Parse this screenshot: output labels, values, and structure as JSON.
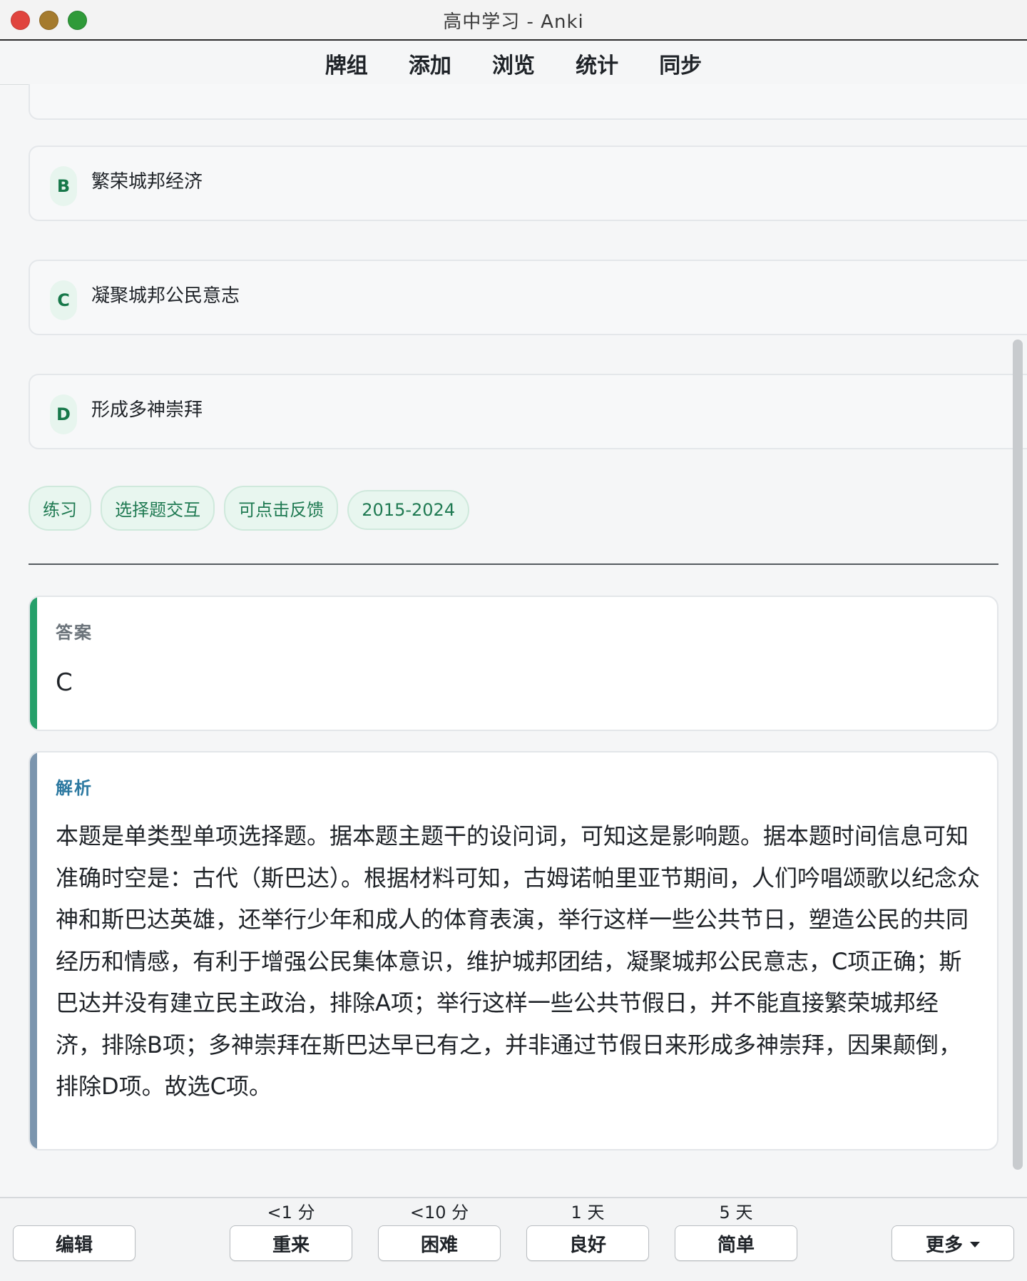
{
  "window": {
    "title": "高中学习 - Anki"
  },
  "toolbar": {
    "items": [
      "牌组",
      "添加",
      "浏览",
      "统计",
      "同步"
    ]
  },
  "options": [
    {
      "letter": "B",
      "text": "繁荣城邦经济"
    },
    {
      "letter": "C",
      "text": "凝聚城邦公民意志"
    },
    {
      "letter": "D",
      "text": "形成多神崇拜"
    }
  ],
  "tags": [
    "练习",
    "选择题交互",
    "可点击反馈",
    "2015-2024"
  ],
  "answer": {
    "label": "答案",
    "value": "C"
  },
  "analysis": {
    "label": "解析",
    "text": "本题是单类型单项选择题。据本题主题干的设问词，可知这是影响题。据本题时间信息可知准确时空是：古代（斯巴达）。根据材料可知，古姆诺帕里亚节期间，人们吟唱颂歌以纪念众神和斯巴达英雄，还举行少年和成人的体育表演，举行这样一些公共节日，塑造公民的共同经历和情感，有利于增强公民集体意识，维护城邦团结，凝聚城邦公民意志，C项正确；斯巴达并没有建立民主政治，排除A项；举行这样一些公共节假日，并不能直接繁荣城邦经济，排除B项；多神崇拜在斯巴达早已有之，并非通过节假日来形成多神崇拜，因果颠倒，排除D项。故选C项。"
  },
  "bottom": {
    "edit": "编辑",
    "more": "更多",
    "again": {
      "interval": "<1 分",
      "label": "重来"
    },
    "hard": {
      "interval": "<10 分",
      "label": "困难"
    },
    "good": {
      "interval": "1 天",
      "label": "良好"
    },
    "easy": {
      "interval": "5 天",
      "label": "简单"
    }
  },
  "colors": {
    "accent_green": "#25a06a",
    "accent_blue": "#7b95ae",
    "tag_text": "#1f7a52"
  }
}
